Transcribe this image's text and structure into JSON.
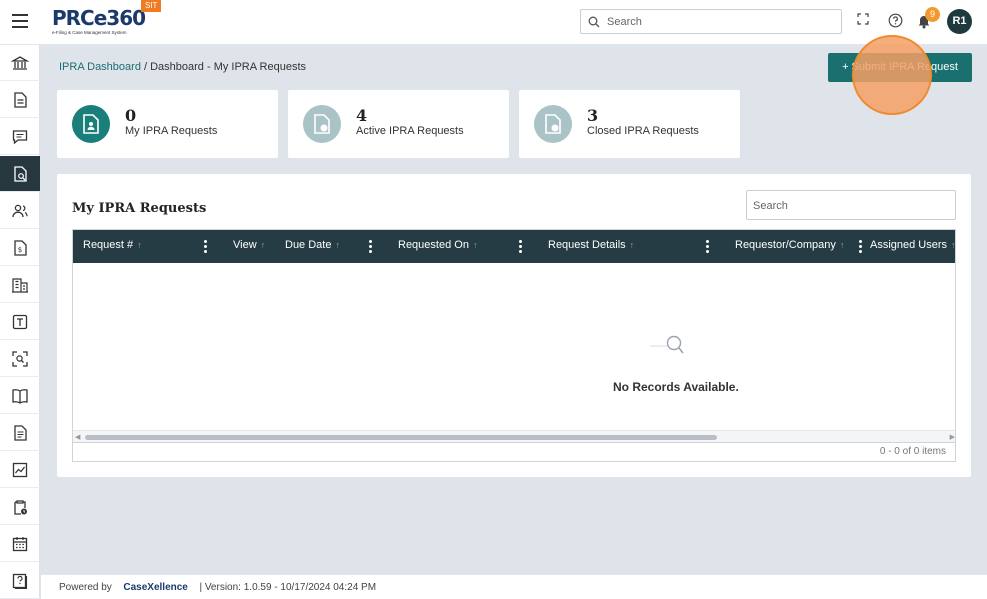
{
  "header": {
    "logo_text": "PRCe360",
    "logo_subtitle": "e-Filing & Case Management System",
    "env_badge": "SIT",
    "search_placeholder": "Search",
    "notifications_count": "9",
    "avatar_initials": "R1"
  },
  "sidebar": {
    "items": [
      {
        "icon": "bank-icon",
        "active": false
      },
      {
        "icon": "document-icon",
        "active": false
      },
      {
        "icon": "chat-icon",
        "active": false
      },
      {
        "icon": "document-search-icon",
        "active": true
      },
      {
        "icon": "users-icon",
        "active": false
      },
      {
        "icon": "invoice-icon",
        "active": false
      },
      {
        "icon": "building-icon",
        "active": false
      },
      {
        "icon": "text-box-icon",
        "active": false
      },
      {
        "icon": "scan-icon",
        "active": false
      },
      {
        "icon": "book-icon",
        "active": false
      },
      {
        "icon": "page-icon",
        "active": false
      },
      {
        "icon": "chart-icon",
        "active": false
      },
      {
        "icon": "clipboard-clock-icon",
        "active": false
      },
      {
        "icon": "calendar-icon",
        "active": false
      },
      {
        "icon": "help-book-icon",
        "active": false
      }
    ]
  },
  "breadcrumb": {
    "link": "IPRA Dashboard",
    "separator": " / ",
    "current": "Dashboard - My IPRA Requests"
  },
  "submit_button": "+ Submit IPRA Request",
  "cards": [
    {
      "count": "0",
      "label": "My IPRA Requests",
      "color": "#1a7f7a"
    },
    {
      "count": "4",
      "label": "Active IPRA Requests",
      "color": "#a9c3c6"
    },
    {
      "count": "3",
      "label": "Closed IPRA Requests",
      "color": "#a9c3c6"
    }
  ],
  "table": {
    "title": "My IPRA Requests",
    "search_placeholder": "Search",
    "columns": [
      "Request #",
      "View",
      "Due Date",
      "Requested On",
      "Request Details",
      "Requestor/Company",
      "Assigned Users"
    ],
    "empty_message": "No Records Available.",
    "pager_text": "0 - 0 of 0 items"
  },
  "footer": {
    "powered_by": "Powered by",
    "brand": "CaseXellence",
    "version": "|  Version: 1.0.59 - 10/17/2024 04:24 PM"
  }
}
